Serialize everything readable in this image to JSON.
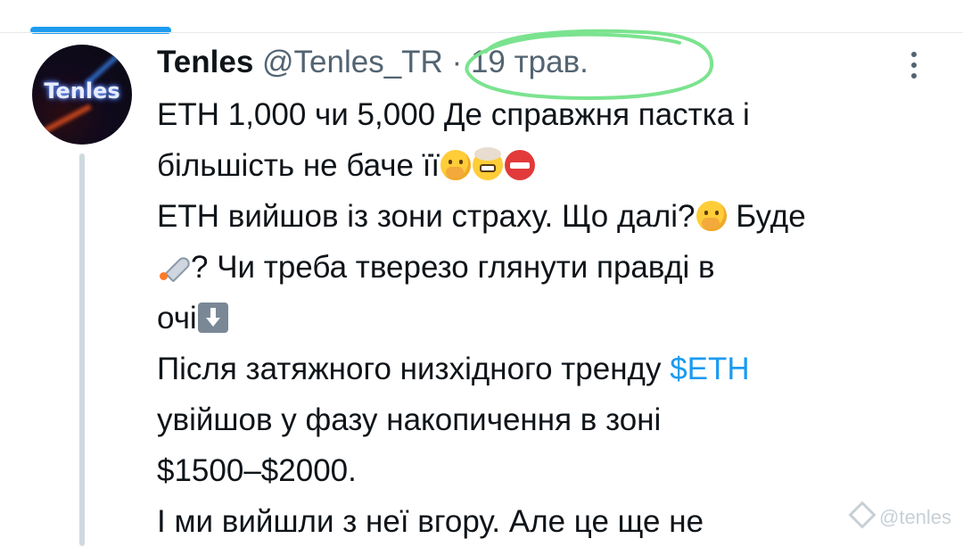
{
  "tweet": {
    "author": {
      "display_name": "Tenles",
      "handle": "@Tenles_TR",
      "avatar_text": "Tenles"
    },
    "separator": "·",
    "date": "19 трав.",
    "lines": [
      {
        "text": "ETH 1,000 чи 5,000 Де справжня пастка і"
      },
      {
        "text": "більшість не баче її"
      },
      {
        "text": "ETH вийшов із зони страху. Що далі?",
        "text_b": " Буде"
      },
      {
        "text": "? Чи  треба тверезо глянути правді в"
      },
      {
        "text": "очі"
      },
      {
        "text": "Після затяжного низхідного тренду ",
        "cashtag": "$ETH"
      },
      {
        "text": "увійшов у фазу накопичення в зоні"
      },
      {
        "text": "$1500–$2000."
      },
      {
        "text": "І ми вийшли з неї вгору. Але це ще не"
      }
    ],
    "emojis": [
      "face-with-hand-over-mouth",
      "exploding-head",
      "no-entry",
      "thinking-face",
      "rocket",
      "down-arrow"
    ]
  },
  "annotation": {
    "type": "hand-drawn-circle",
    "color": "#7be38f"
  },
  "watermark": {
    "text": "@tenles"
  },
  "colors": {
    "accent": "#1d9bf0",
    "text": "#0f1419",
    "secondary": "#536471",
    "thread_line": "#cfd9de"
  }
}
